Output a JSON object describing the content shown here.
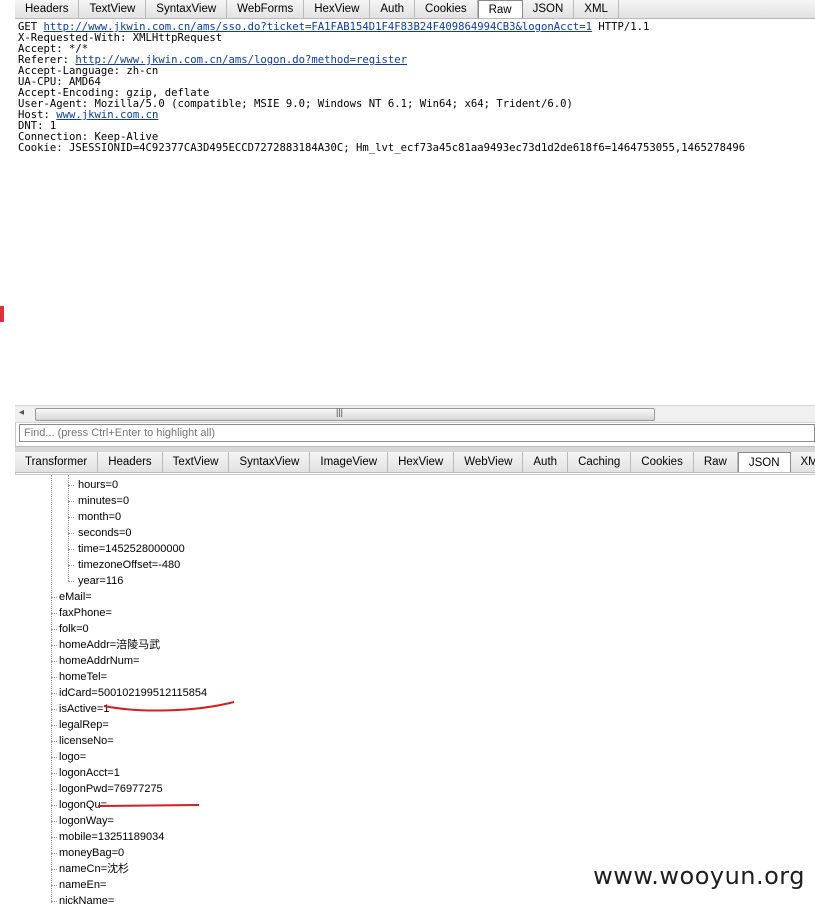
{
  "top_tabs": [
    "Headers",
    "TextView",
    "SyntaxView",
    "WebForms",
    "HexView",
    "Auth",
    "Cookies",
    "Raw",
    "JSON",
    "XML"
  ],
  "top_selected": "Raw",
  "request": {
    "line1_prefix": "GET ",
    "line1_url": "http://www.jkwin.com.cn/ams/sso.do?ticket=FA1FAB154D1F4F83B24F409864994CB3&logonAcct=1",
    "line1_suffix": " HTTP/1.1",
    "x_requested_with": "X-Requested-With: XMLHttpRequest",
    "accept": "Accept: */*",
    "referer_label": "Referer: ",
    "referer_url": "http://www.jkwin.com.cn/ams/logon.do?method=register",
    "accept_language": "Accept-Language: zh-cn",
    "ua_cpu": "UA-CPU: AMD64",
    "accept_encoding": "Accept-Encoding: gzip, deflate",
    "user_agent": "User-Agent: Mozilla/5.0 (compatible; MSIE 9.0; Windows NT 6.1; Win64; x64; Trident/6.0)",
    "host_label": "Host: ",
    "host_url": "www.jkwin.com.cn",
    "dnt": "DNT: 1",
    "connection": "Connection: Keep-Alive",
    "cookie": "Cookie: JSESSIONID=4C92377CA3D495ECCD7272883184A30C; Hm_lvt_ecf73a45c81aa9493ec73d1d2de618f6=1464753055,1465278496"
  },
  "find_placeholder": "Find... (press Ctrl+Enter to highlight all)",
  "bottom_tabs": [
    "Transformer",
    "Headers",
    "TextView",
    "SyntaxView",
    "ImageView",
    "HexView",
    "WebView",
    "Auth",
    "Caching",
    "Cookies",
    "Raw",
    "JSON",
    "XML"
  ],
  "bottom_selected": "JSON",
  "tree_children": [
    "hours=0",
    "minutes=0",
    "month=0",
    "seconds=0",
    "time=1452528000000",
    "timezoneOffset=-480",
    "year=116"
  ],
  "tree_fields": [
    "eMail=",
    "faxPhone=",
    "folk=0",
    "homeAddr=涪陵马武",
    "homeAddrNum=",
    "homeTel=",
    "idCard=500102199512115854",
    "isActive=1",
    "legalRep=",
    "licenseNo=",
    "logo=",
    "logonAcct=1",
    "logonPwd=76977275",
    "logonQu=",
    "logonWay=",
    "mobile=13251189034",
    "moneyBag=0",
    "nameCn=沈杉",
    "nameEn=",
    "nickName="
  ],
  "watermark": "www.wooyun.org",
  "colors": {
    "link": "#0b3da3",
    "annotation": "#d41f1f"
  }
}
